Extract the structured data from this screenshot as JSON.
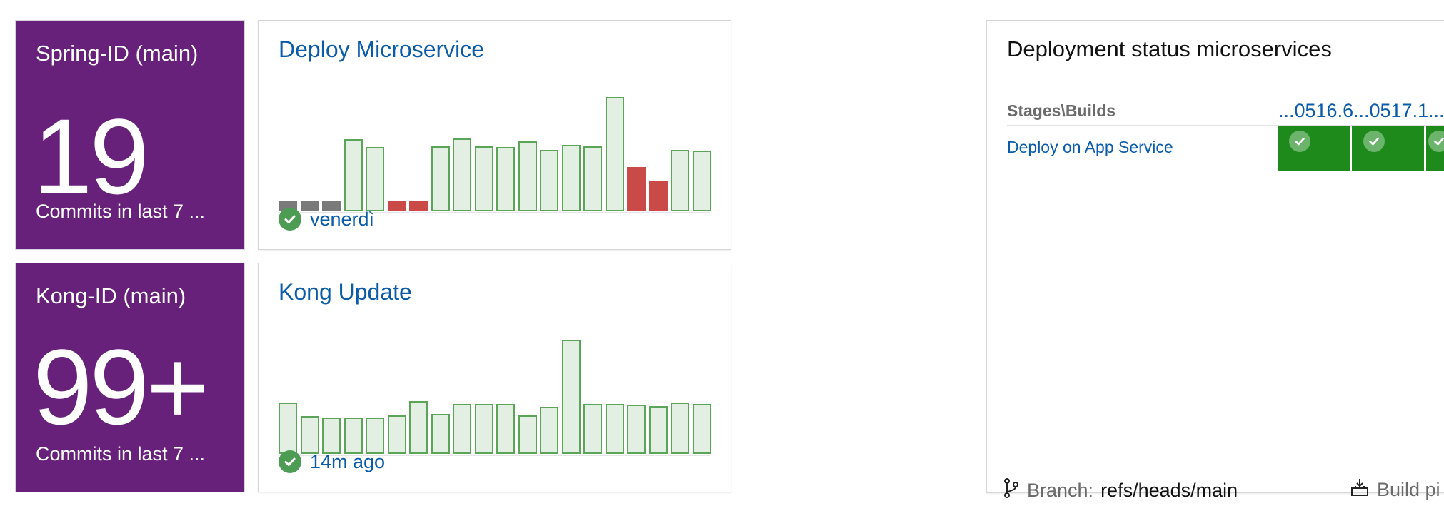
{
  "tiles": [
    {
      "title": "Spring-ID (main)",
      "number": "19",
      "subtitle": "Commits in last 7 ..."
    },
    {
      "title": "Kong-ID (main)",
      "number": "99+",
      "subtitle": "Commits in last 7 ..."
    }
  ],
  "pipelines": [
    {
      "title": "Deploy Microservice",
      "status_text": "venerdì",
      "status": "succeeded",
      "bars": [
        {
          "v": 0.09,
          "s": "gray"
        },
        {
          "v": 0.09,
          "s": "gray"
        },
        {
          "v": 0.09,
          "s": "gray"
        },
        {
          "v": 0.63,
          "s": "ok"
        },
        {
          "v": 0.56,
          "s": "ok"
        },
        {
          "v": 0.09,
          "s": "fail"
        },
        {
          "v": 0.09,
          "s": "fail"
        },
        {
          "v": 0.57,
          "s": "ok"
        },
        {
          "v": 0.64,
          "s": "ok"
        },
        {
          "v": 0.57,
          "s": "ok"
        },
        {
          "v": 0.56,
          "s": "ok"
        },
        {
          "v": 0.61,
          "s": "ok"
        },
        {
          "v": 0.54,
          "s": "ok"
        },
        {
          "v": 0.58,
          "s": "ok"
        },
        {
          "v": 0.57,
          "s": "ok"
        },
        {
          "v": 1.0,
          "s": "ok"
        },
        {
          "v": 0.39,
          "s": "fail"
        },
        {
          "v": 0.27,
          "s": "fail"
        },
        {
          "v": 0.54,
          "s": "ok"
        },
        {
          "v": 0.53,
          "s": "ok"
        }
      ]
    },
    {
      "title": "Kong Update",
      "status_text": "14m ago",
      "status": "succeeded",
      "bars": [
        {
          "v": 0.45,
          "s": "ok"
        },
        {
          "v": 0.33,
          "s": "ok"
        },
        {
          "v": 0.32,
          "s": "ok"
        },
        {
          "v": 0.32,
          "s": "ok"
        },
        {
          "v": 0.32,
          "s": "ok"
        },
        {
          "v": 0.34,
          "s": "ok"
        },
        {
          "v": 0.46,
          "s": "ok"
        },
        {
          "v": 0.35,
          "s": "ok"
        },
        {
          "v": 0.44,
          "s": "ok"
        },
        {
          "v": 0.44,
          "s": "ok"
        },
        {
          "v": 0.44,
          "s": "ok"
        },
        {
          "v": 0.34,
          "s": "ok"
        },
        {
          "v": 0.41,
          "s": "ok"
        },
        {
          "v": 1.0,
          "s": "ok"
        },
        {
          "v": 0.44,
          "s": "ok"
        },
        {
          "v": 0.44,
          "s": "ok"
        },
        {
          "v": 0.43,
          "s": "ok"
        },
        {
          "v": 0.42,
          "s": "ok"
        },
        {
          "v": 0.45,
          "s": "ok"
        },
        {
          "v": 0.44,
          "s": "ok"
        }
      ]
    }
  ],
  "deployment": {
    "title": "Deployment status microservices",
    "stages_header": "Stages\\Builds",
    "builds": [
      "...0516.6",
      "...0517.1",
      "..."
    ],
    "stage": "Deploy on App Service",
    "branch_label": "Branch:",
    "branch_value": "refs/heads/main",
    "build_pipeline_label": "Build pi"
  },
  "colors": {
    "tile_bg": "#68217a",
    "link": "#0a5ca8",
    "success_bar": "#5aa557",
    "fail_bar": "#c94a46",
    "stage_success": "#1e8a1c"
  }
}
